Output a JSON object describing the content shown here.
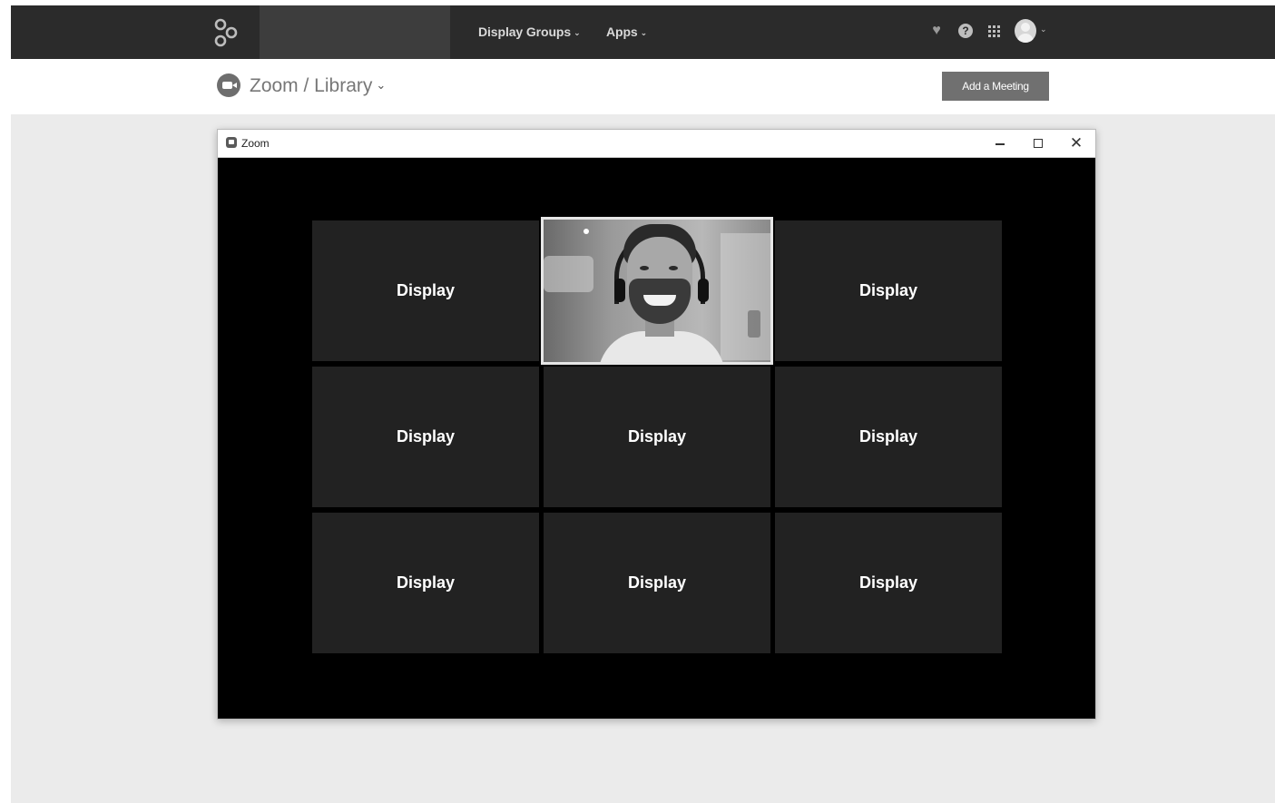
{
  "topbar": {
    "nav": [
      {
        "label": "Display Groups",
        "icon": "chevron-down-icon"
      },
      {
        "label": "Apps",
        "icon": "chevron-down-icon"
      }
    ],
    "icons": [
      "heart-icon",
      "help-icon",
      "apps-grid-icon",
      "avatar",
      "chevron-down-icon"
    ]
  },
  "subheader": {
    "breadcrumb": "Zoom / Library",
    "add_button": "Add a Meeting"
  },
  "zoom_window": {
    "title": "Zoom",
    "controls": [
      "minimize-icon",
      "maximize-icon",
      "close-icon"
    ],
    "tiles": [
      {
        "type": "display",
        "label": "Display"
      },
      {
        "type": "video"
      },
      {
        "type": "display",
        "label": "Display"
      },
      {
        "type": "display",
        "label": "Display"
      },
      {
        "type": "display",
        "label": "Display"
      },
      {
        "type": "display",
        "label": "Display"
      },
      {
        "type": "display",
        "label": "Display"
      },
      {
        "type": "display",
        "label": "Display"
      },
      {
        "type": "display",
        "label": "Display"
      }
    ]
  },
  "colors": {
    "topbar": "#2b2b2b",
    "page_bg": "#ebebeb",
    "tile_bg": "#222222",
    "window_bg": "#000000",
    "button_bg": "#707070"
  }
}
